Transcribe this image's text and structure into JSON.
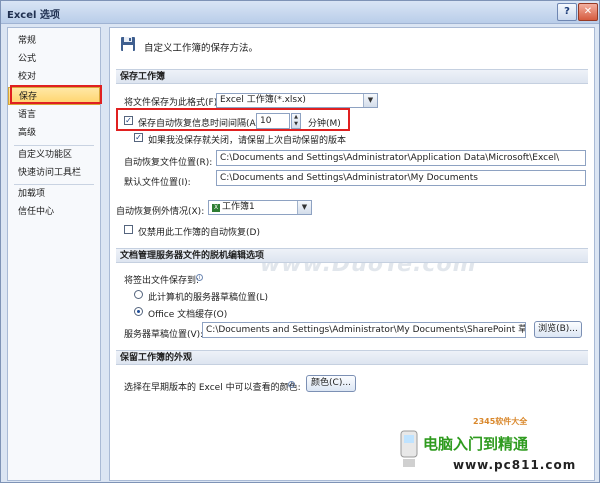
{
  "window": {
    "title": "Excel 选项",
    "help_label": "?",
    "close_label": "✕"
  },
  "sidebar": {
    "items": [
      {
        "label": "常规"
      },
      {
        "label": "公式"
      },
      {
        "label": "校对"
      },
      {
        "label": "保存"
      },
      {
        "label": "语言"
      },
      {
        "label": "高级"
      },
      {
        "label": "自定义功能区"
      },
      {
        "label": "快速访问工具栏"
      },
      {
        "label": "加载项"
      },
      {
        "label": "信任中心"
      }
    ]
  },
  "header": {
    "text": "自定义工作簿的保存方法。",
    "icon": "floppy-disk-icon"
  },
  "save_workbooks": {
    "section_title": "保存工作簿",
    "format_label": "将文件保存为此格式(F):",
    "format_value": "Excel 工作簿(*.xlsx)",
    "autorecover_checked": true,
    "autorecover_label": "保存自动恢复信息时间间隔(A)",
    "autorecover_minutes": "10",
    "minutes_label": "分钟(M)",
    "keep_last_checked": true,
    "keep_last_label": "如果我没保存就关闭，请保留上次自动保留的版本",
    "autorecover_location_label": "自动恢复文件位置(R):",
    "autorecover_location_value": "C:\\Documents and Settings\\Administrator\\Application Data\\Microsoft\\Excel\\",
    "default_location_label": "默认文件位置(I):",
    "default_location_value": "C:\\Documents and Settings\\Administrator\\My Documents"
  },
  "autorecover_exceptions": {
    "label": "自动恢复例外情况(X):",
    "workbook_value": "工作簿1",
    "disable_checked": false,
    "disable_label": "仅禁用此工作簿的自动恢复(D)"
  },
  "watermark": "www.DuoTe.com",
  "offline_editing": {
    "section_title": "文档管理服务器文件的脱机编辑选项",
    "save_to_label": "将签出文件保存到:",
    "option_server_label": "此计算机的服务器草稿位置(L)",
    "option_server_selected": false,
    "option_cache_label": "Office 文档缓存(O)",
    "option_cache_selected": true,
    "drafts_label": "服务器草稿位置(V):",
    "drafts_value": "C:\\Documents and Settings\\Administrator\\My Documents\\SharePoint 草稿\\",
    "browse_label": "浏览(B)..."
  },
  "appearance": {
    "section_title": "保留工作簿的外观",
    "colors_label": "选择在早期版本的 Excel 中可以查看的颜色:",
    "colors_button": "颜色(C)..."
  },
  "branding": {
    "small": "2345软件大全",
    "main": "电脑入门到精通",
    "url": "www.pc811.com"
  }
}
